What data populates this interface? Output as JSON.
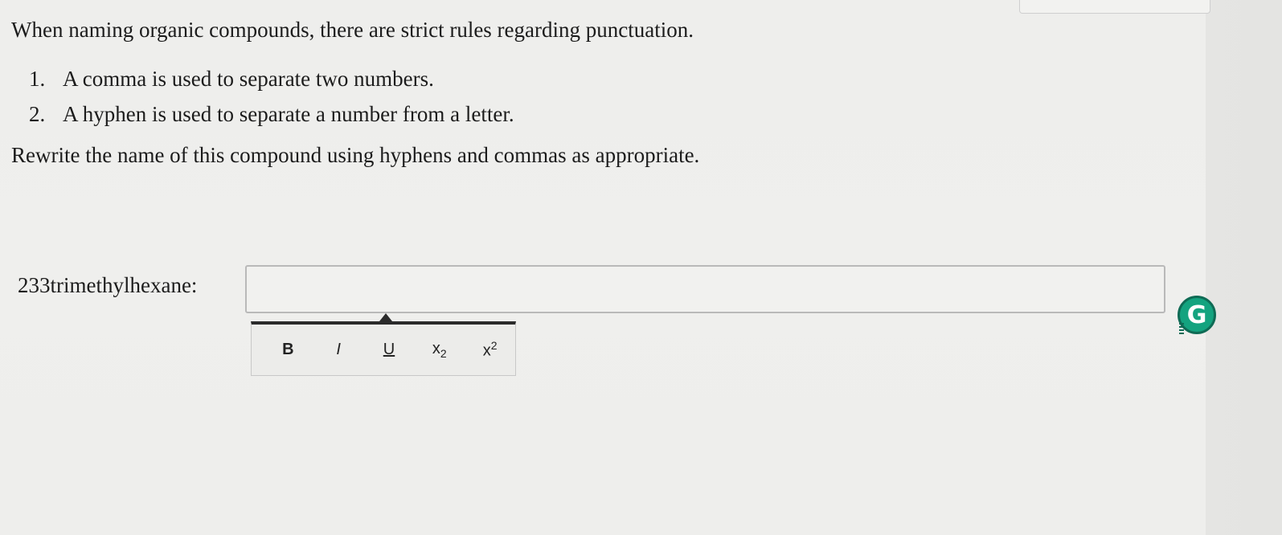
{
  "question": {
    "intro": "When naming organic compounds, there are strict rules regarding punctuation.",
    "rules": [
      {
        "number": "1.",
        "text": "A comma is used to separate two numbers."
      },
      {
        "number": "2.",
        "text": "A hyphen is used to separate a number from a letter."
      }
    ],
    "instruction": "Rewrite the name of this compound using hyphens and commas as appropriate."
  },
  "answer": {
    "compound_label": "233trimethylhexane:",
    "input_value": "",
    "input_placeholder": ""
  },
  "toolbar": {
    "bold_label": "B",
    "italic_label": "I",
    "underline_label": "U",
    "subscript_base": "x",
    "subscript_label": "2",
    "superscript_base": "x",
    "superscript_label": "2"
  },
  "grammarly": {
    "label": "G",
    "icon": "grammarly-icon",
    "color": "#14a37f"
  }
}
